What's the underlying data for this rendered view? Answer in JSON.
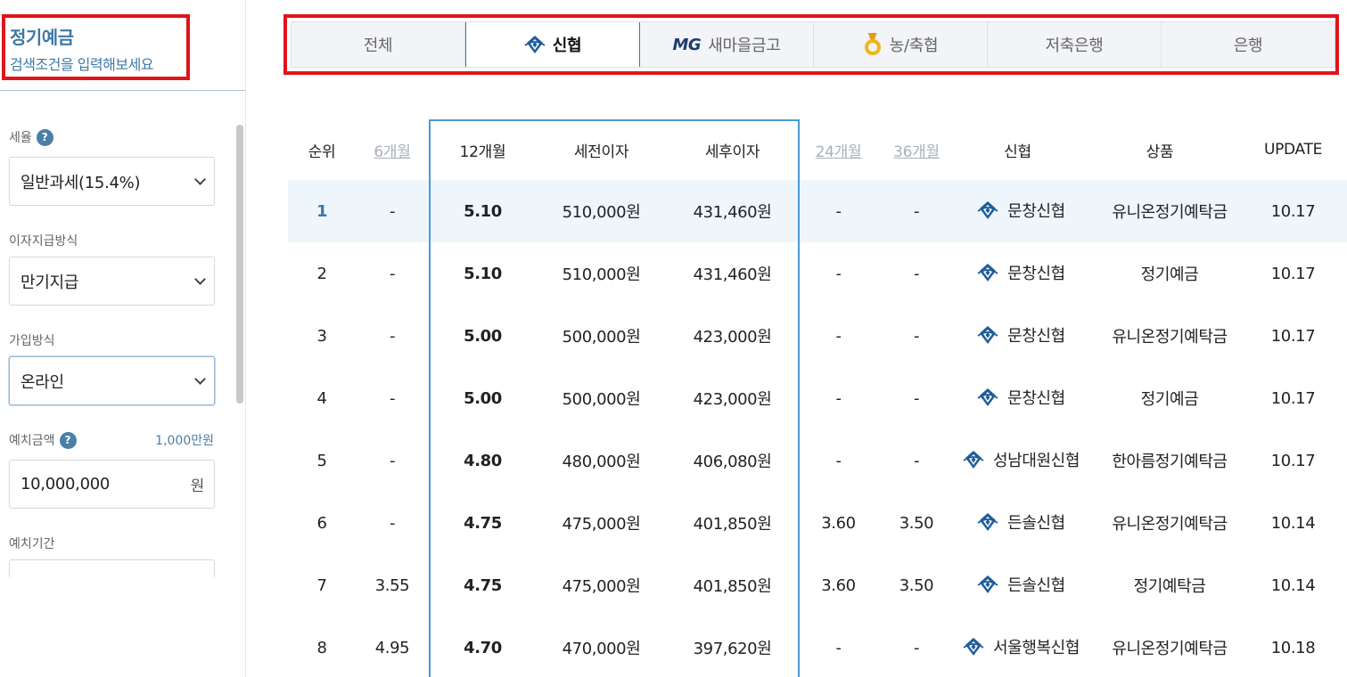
{
  "sidebar": {
    "title": "정기예금",
    "subtitle": "검색조건을 입력해보세요",
    "tax": {
      "label": "세율",
      "help": "?",
      "value": "일반과세(15.4%)"
    },
    "payout": {
      "label": "이자지급방식",
      "value": "만기지급"
    },
    "join": {
      "label": "가입방식",
      "value": "온라인"
    },
    "deposit": {
      "label": "예치금액",
      "help": "?",
      "hint": "1,000만원",
      "value": "10,000,000",
      "unit": "원"
    },
    "period": {
      "label": "예치기간"
    }
  },
  "tabs": [
    {
      "label": "전체",
      "icon": ""
    },
    {
      "label": "신협",
      "icon": "shinhyup-logo-icon",
      "active": true
    },
    {
      "label": "새마을금고",
      "icon": "mg-logo-icon",
      "logo_text": "MG"
    },
    {
      "label": "농/축협",
      "icon": "medal-logo-icon"
    },
    {
      "label": "저축은행",
      "icon": ""
    },
    {
      "label": "은행",
      "icon": ""
    }
  ],
  "table": {
    "headers": [
      "순위",
      "6개월",
      "12개월",
      "세전이자",
      "세후이자",
      "24개월",
      "36개월",
      "신협",
      "상품",
      "UPDATE"
    ],
    "rows": [
      [
        "1",
        "-",
        "5.10",
        "510,000원",
        "431,460원",
        "-",
        "-",
        "문창신협",
        "유니온정기예탁금",
        "10.17"
      ],
      [
        "2",
        "-",
        "5.10",
        "510,000원",
        "431,460원",
        "-",
        "-",
        "문창신협",
        "정기예금",
        "10.17"
      ],
      [
        "3",
        "-",
        "5.00",
        "500,000원",
        "423,000원",
        "-",
        "-",
        "문창신협",
        "유니온정기예탁금",
        "10.17"
      ],
      [
        "4",
        "-",
        "5.00",
        "500,000원",
        "423,000원",
        "-",
        "-",
        "문창신협",
        "정기예금",
        "10.17"
      ],
      [
        "5",
        "-",
        "4.80",
        "480,000원",
        "406,080원",
        "-",
        "-",
        "성남대원신협",
        "한아름정기예탁금",
        "10.17"
      ],
      [
        "6",
        "-",
        "4.75",
        "475,000원",
        "401,850원",
        "3.60",
        "3.50",
        "든솔신협",
        "유니온정기예탁금",
        "10.14"
      ],
      [
        "7",
        "3.55",
        "4.75",
        "475,000원",
        "401,850원",
        "3.60",
        "3.50",
        "든솔신협",
        "정기예탁금",
        "10.14"
      ],
      [
        "8",
        "4.95",
        "4.70",
        "470,000원",
        "397,620원",
        "-",
        "-",
        "서울행복신협",
        "유니온정기예탁금",
        "10.18"
      ]
    ]
  },
  "colors": {
    "accent": "#3d78a6",
    "rate": "#b5284f",
    "annotation": "#e0141b",
    "selected_row": "#eef6fc"
  }
}
